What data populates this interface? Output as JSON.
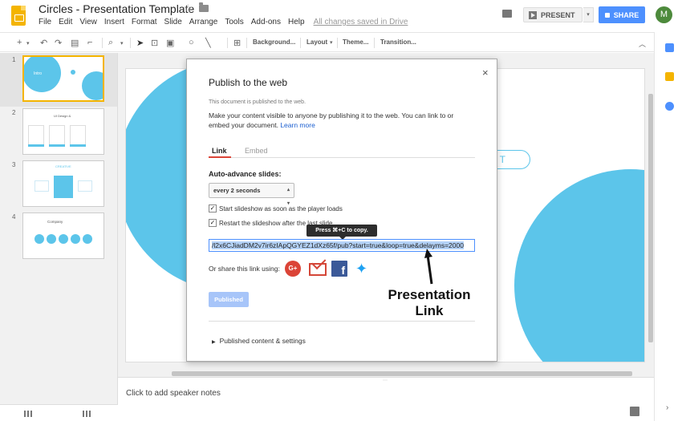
{
  "doc": {
    "title": "Circles - Presentation Template"
  },
  "menu": {
    "items": [
      "File",
      "Edit",
      "View",
      "Insert",
      "Format",
      "Slide",
      "Arrange",
      "Tools",
      "Add-ons",
      "Help"
    ],
    "saved_status": "All changes saved in Drive"
  },
  "header": {
    "present_label": "PRESENT",
    "share_label": "SHARE",
    "avatar_initial": "M"
  },
  "toolbar": {
    "background_label": "Background...",
    "layout_label": "Layout",
    "theme_label": "Theme...",
    "transition_label": "Transition..."
  },
  "filmstrip": {
    "slides": [
      {
        "number": "1",
        "title": "Intro"
      },
      {
        "number": "2",
        "title": "UI Design &"
      },
      {
        "number": "3",
        "title": "CREATIVE"
      },
      {
        "number": "4",
        "title": "Company"
      }
    ]
  },
  "slide": {
    "button_text": "T"
  },
  "notes": {
    "placeholder": "Click to add speaker notes"
  },
  "dialog": {
    "title": "Publish to the web",
    "close": "×",
    "status": "This document is published to the web.",
    "description": "Make your content visible to anyone by publishing it to the web. You can link to or embed your document.",
    "learn_more": "Learn more",
    "tabs": [
      "Link",
      "Embed"
    ],
    "auto_advance_label": "Auto-advance slides:",
    "auto_advance_value": "every 2 seconds",
    "checkbox_start": "Start slideshow as soon as the player loads",
    "checkbox_restart": "Restart the slideshow after the last slide",
    "tooltip": "Press ⌘+C to copy.",
    "link_url": "/l2x6CJiadDM2v7ir6zIApQGYEZ1dXz65f/pub?start=true&loop=true&delayms=2000",
    "share_label": "Or share this link using:",
    "published_button": "Published",
    "published_settings": "Published content & settings"
  },
  "annotation": {
    "line1": "Presentation",
    "line2": "Link"
  },
  "colors": {
    "accent_circle": "#5cc5ea",
    "share_blue": "#4d90fe",
    "docs_yellow": "#f4b400"
  }
}
